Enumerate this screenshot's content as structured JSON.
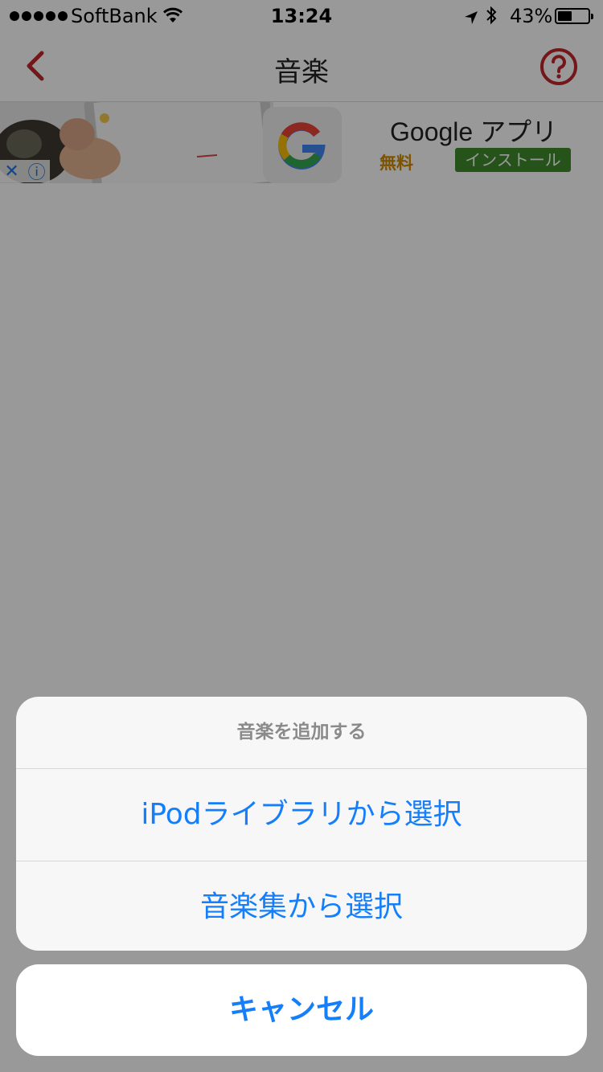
{
  "status_bar": {
    "carrier": "SoftBank",
    "time": "13:24",
    "battery": "43%",
    "battery_level": 0.43
  },
  "nav": {
    "title": "音楽",
    "back_icon": "chevron-left-icon",
    "help_icon": "question-circle-icon",
    "accent_color": "#c1272d"
  },
  "ad": {
    "app_name": "Google アプリ",
    "price": "無料",
    "install_label": "インストール",
    "close_icon": "close-icon",
    "info_icon": "info-icon"
  },
  "action_sheet": {
    "title": "音楽を追加する",
    "options": [
      {
        "label": "iPodライブラリから選択"
      },
      {
        "label": "音楽集から選択"
      }
    ],
    "cancel_label": "キャンセル",
    "button_color": "#147efb"
  }
}
